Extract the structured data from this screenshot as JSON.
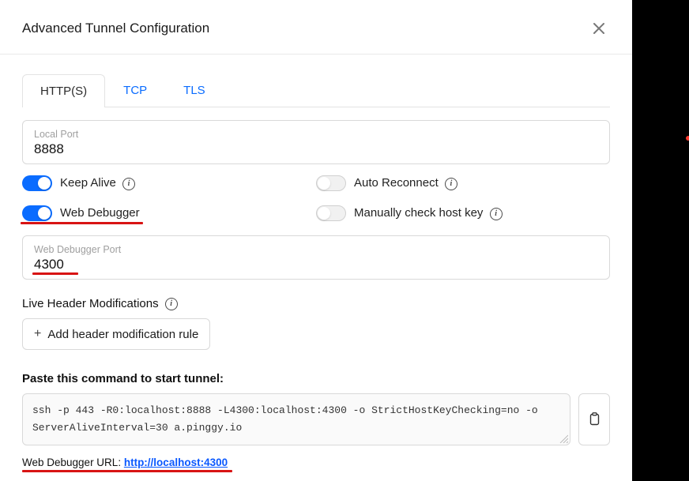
{
  "title": "Advanced Tunnel Configuration",
  "tabs": {
    "https": "HTTP(S)",
    "tcp": "TCP",
    "tls": "TLS"
  },
  "localPort": {
    "label": "Local Port",
    "value": "8888"
  },
  "toggles": {
    "keepAlive": "Keep Alive",
    "autoReconnect": "Auto Reconnect",
    "webDebugger": "Web Debugger",
    "hostKey": "Manually check host key"
  },
  "webDebuggerPort": {
    "label": "Web Debugger Port",
    "value": "4300"
  },
  "liveHeaders": "Live Header Modifications",
  "addRule": "Add header modification rule",
  "cmd": {
    "title": "Paste this command to start tunnel:",
    "value": "ssh -p 443 -R0:localhost:8888  -L4300:localhost:4300 -o StrictHostKeyChecking=no -o ServerAliveInterval=30 a.pinggy.io"
  },
  "debuggerUrl": {
    "label": "Web Debugger URL: ",
    "href": "http://localhost:4300"
  }
}
